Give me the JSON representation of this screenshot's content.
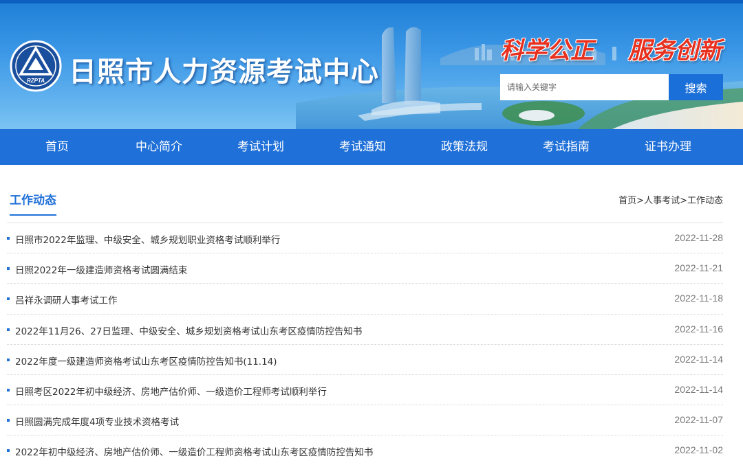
{
  "header": {
    "site_title": "日照市人力资源考试中心",
    "logo_text": "RZPTA",
    "slogan_1": "科学公正",
    "slogan_2": "服务创新",
    "search_placeholder": "请输入关键字",
    "search_button": "搜索"
  },
  "nav": {
    "items": [
      "首页",
      "中心简介",
      "考试计划",
      "考试通知",
      "政策法规",
      "考试指南",
      "证书办理"
    ]
  },
  "section": {
    "title": "工作动态",
    "breadcrumb": [
      "首页",
      "人事考试",
      "工作动态"
    ],
    "breadcrumb_separator": ">"
  },
  "news": [
    {
      "title": "日照市2022年监理、中级安全、城乡规划职业资格考试顺利举行",
      "date": "2022-11-28"
    },
    {
      "title": "日照2022年一级建造师资格考试圆满结束",
      "date": "2022-11-21"
    },
    {
      "title": "吕祥永调研人事考试工作",
      "date": "2022-11-18"
    },
    {
      "title": "2022年11月26、27日监理、中级安全、城乡规划资格考试山东考区疫情防控告知书",
      "date": "2022-11-16"
    },
    {
      "title": "2022年度一级建造师资格考试山东考区疫情防控告知书(11.14)",
      "date": "2022-11-14"
    },
    {
      "title": "日照考区2022年初中级经济、房地产估价师、一级造价工程师考试顺利举行",
      "date": "2022-11-14"
    },
    {
      "title": "日照圆满完成年度4项专业技术资格考试",
      "date": "2022-11-07"
    },
    {
      "title": "2022年初中级经济、房地产估价师、一级造价工程师资格考试山东考区疫情防控告知书",
      "date": "2022-11-02"
    }
  ],
  "colors": {
    "primary_blue": "#1f70d8",
    "slogan_red": "#e8301f",
    "text": "#333333",
    "date": "#777777"
  }
}
